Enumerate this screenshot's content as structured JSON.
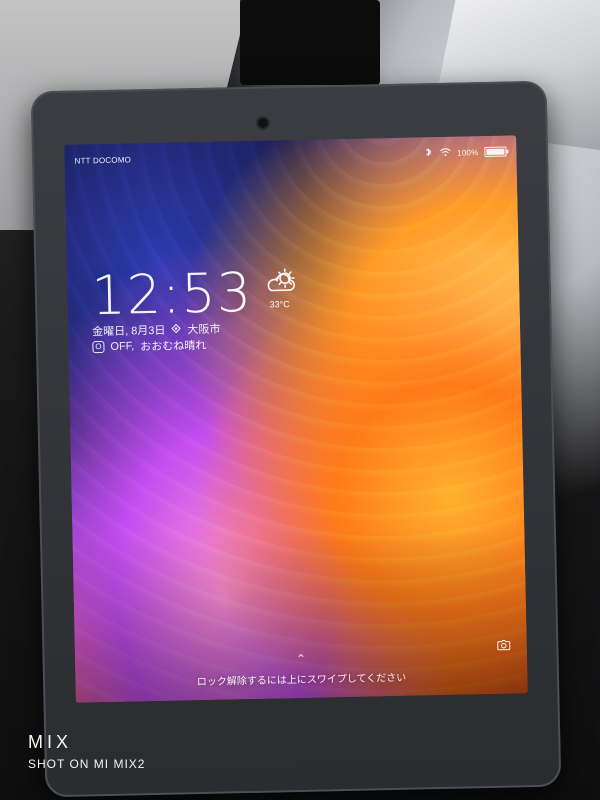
{
  "lock_screen": {
    "status_bar": {
      "carrier": "NTT DOCOMO",
      "battery": {
        "label": "100%",
        "level": 1.0
      },
      "icons": [
        "bluetooth-icon",
        "wifi-icon",
        "battery-icon"
      ]
    },
    "clock": {
      "time": "12:53"
    },
    "weather": {
      "temperature": "33°C",
      "icon": "cloud-sun-icon"
    },
    "date_location": {
      "date": "金曜日, 8月3日",
      "location": "大阪市",
      "location_icon": "location-icon"
    },
    "summary": {
      "alarm_badge": "O",
      "alarm": "OFF,",
      "condition": "おおむね晴れ"
    },
    "unlock": {
      "hint": "ロック解除するには上にスワイプしてください",
      "chevron_icon": "chevron-up-icon",
      "camera_icon": "camera-icon"
    }
  },
  "photo_watermark": {
    "brand": "MIX",
    "shot_on": "SHOT ON MI MIX2"
  },
  "colors": {
    "accent_orange": "#ff7a1a",
    "accent_purple": "#b24df0",
    "tablet_frame": "#2a2c30"
  }
}
